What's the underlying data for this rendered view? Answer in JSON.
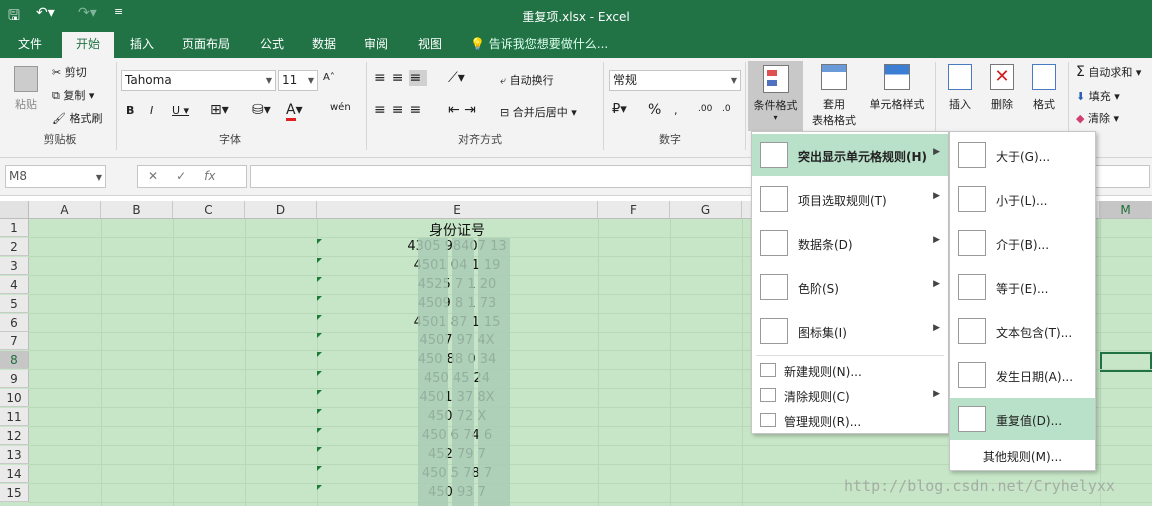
{
  "window": {
    "title": "重复项.xlsx - Excel"
  },
  "tabs": [
    "文件",
    "开始",
    "插入",
    "页面布局",
    "公式",
    "数据",
    "审阅",
    "视图"
  ],
  "tell_me": "告诉我您想要做什么...",
  "clipboard": {
    "paste": "粘贴",
    "cut": "剪切",
    "copy": "复制",
    "format_painter": "格式刷",
    "group": "剪贴板"
  },
  "font": {
    "name": "Tahoma",
    "size": "11",
    "group": "字体",
    "wen": "wén"
  },
  "alignment": {
    "wrap": "自动换行",
    "merge": "合并后居中",
    "group": "对齐方式"
  },
  "number": {
    "format": "常规",
    "group": "数字"
  },
  "styles": {
    "conditional": "条件格式",
    "table_line1": "套用",
    "table_line2": "表格格式",
    "cell_styles": "单元格样式"
  },
  "cells": {
    "insert": "插入",
    "delete": "删除",
    "format": "格式"
  },
  "editing": {
    "autosum": "自动求和",
    "fill": "填充",
    "clear": "清除"
  },
  "formula_bar": {
    "name_box": "M8",
    "fx": "fx"
  },
  "columns": [
    "A",
    "B",
    "C",
    "D",
    "E",
    "F",
    "G",
    "M"
  ],
  "rows": [
    "1",
    "2",
    "3",
    "4",
    "5",
    "6",
    "7",
    "8",
    "9",
    "10",
    "11",
    "12",
    "13",
    "14",
    "15"
  ],
  "sheet": {
    "header": "身份证号",
    "values": [
      "4305    98407    13",
      "4501    04    1  19",
      "4525    7    1  20",
      "4509    8    1  73",
      "4501    87    1  15",
      "4507    97       4X",
      "450     88    0  34",
      "450     45       24",
      "4501    37       8X",
      "450     72       X",
      "450  6  74       6",
      "452     79       7",
      "450  5  78       7",
      "450     93       7"
    ]
  },
  "cf_menu": {
    "items": [
      "突出显示单元格规则(H)",
      "项目选取规则(T)",
      "数据条(D)",
      "色阶(S)",
      "图标集(I)"
    ],
    "small_items": [
      "新建规则(N)...",
      "清除规则(C)",
      "管理规则(R)..."
    ]
  },
  "highlight_menu": {
    "items": [
      "大于(G)...",
      "小于(L)...",
      "介于(B)...",
      "等于(E)...",
      "文本包含(T)...",
      "发生日期(A)...",
      "重复值(D)..."
    ],
    "more": "其他规则(M)..."
  },
  "watermark": "http://blog.csdn.net/Cryhelyxx"
}
